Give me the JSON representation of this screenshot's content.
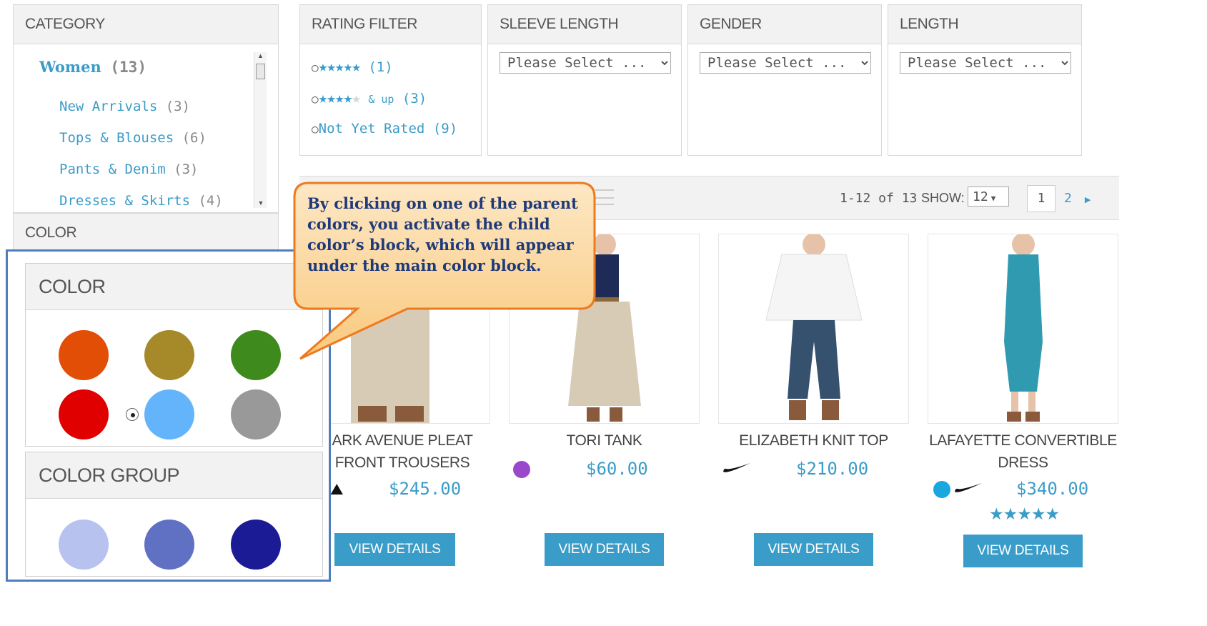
{
  "category": {
    "heading": "CATEGORY",
    "root": {
      "name": "Women",
      "count": "(13)"
    },
    "items": [
      {
        "name": "New Arrivals",
        "count": "(3)"
      },
      {
        "name": "Tops & Blouses",
        "count": "(6)"
      },
      {
        "name": "Pants & Denim",
        "count": "(3)"
      },
      {
        "name": "Dresses & Skirts",
        "count": "(4)"
      }
    ]
  },
  "color_heading_behind": "COLOR",
  "rating": {
    "heading": "RATING FILTER",
    "options": [
      {
        "stars_on": "★★★★★",
        "stars_off": "",
        "suffix": "",
        "count": "(1)"
      },
      {
        "stars_on": "★★★★",
        "stars_off": "★",
        "suffix": "& up",
        "count": "(3)"
      },
      {
        "label": "Not Yet Rated",
        "count": "(9)"
      }
    ]
  },
  "filters": [
    {
      "heading": "SLEEVE LENGTH",
      "placeholder": "Please Select ..."
    },
    {
      "heading": "GENDER",
      "placeholder": "Please Select ..."
    },
    {
      "heading": "LENGTH",
      "placeholder": "Please Select ..."
    }
  ],
  "toolbar": {
    "range": "1-12 of 13",
    "show_label": "SHOW:",
    "show_value": "12",
    "pages": [
      "1",
      "2"
    ],
    "next_icon": "triangle-right"
  },
  "callout": {
    "text": "By clicking on one of the parent colors, you activate the child color’s block, which will appear under the main color block."
  },
  "zoom": {
    "color_heading": "COLOR",
    "group_heading": "COLOR GROUP",
    "parent_colors": [
      "#e34e07",
      "#a68a2a",
      "#3f8a1c",
      "#e00000",
      "#63b4fb",
      "#999999"
    ],
    "selected_index": 4,
    "group_colors": [
      "#b8c2ee",
      "#6071c3",
      "#1b1b96"
    ]
  },
  "products": [
    {
      "title_lines": [
        "ARK AVENUE PLEAT",
        "FRONT TROUSERS"
      ],
      "price": "$245.00",
      "button": "VIEW DETAILS",
      "brand_icon": "adidas-icon"
    },
    {
      "title_lines": [
        "TORI TANK"
      ],
      "price": "$60.00",
      "button": "VIEW DETAILS",
      "swatch": "#9a47cc"
    },
    {
      "title_lines": [
        "ELIZABETH KNIT TOP"
      ],
      "price": "$210.00",
      "button": "VIEW DETAILS",
      "brand_icon": "nike-swoosh-icon"
    },
    {
      "title_lines": [
        "LAFAYETTE CONVERTIBLE",
        "DRESS"
      ],
      "price": "$340.00",
      "button": "VIEW DETAILS",
      "swatch": "#19a7e0",
      "brand_icon": "nike-swoosh-icon",
      "rating_stars": "★★★★★"
    }
  ]
}
